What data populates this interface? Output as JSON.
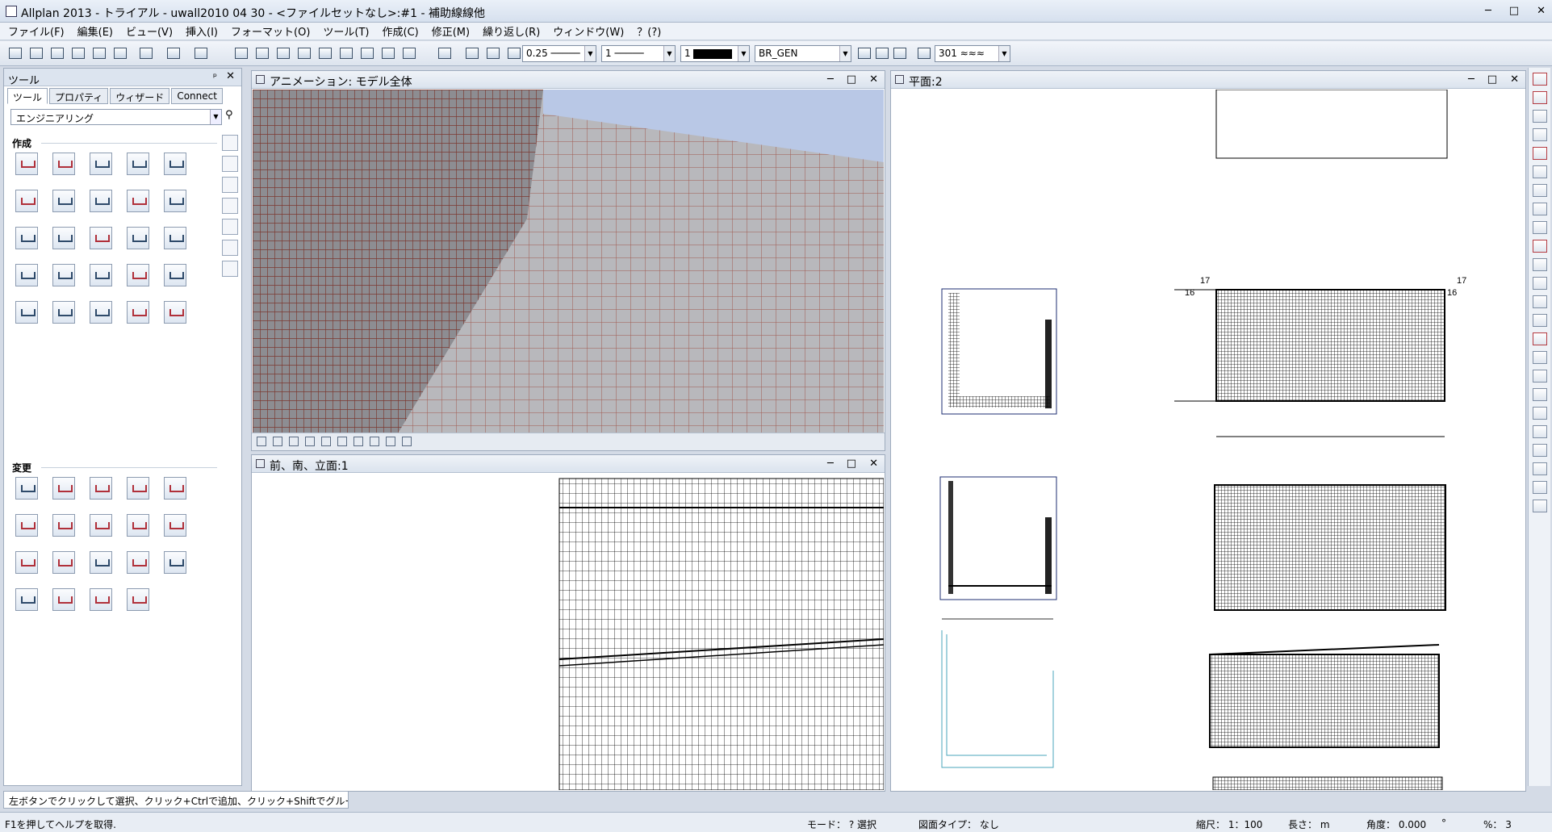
{
  "window": {
    "title": "Allplan 2013 - トライアル - uwall2010 04 30 - <ファイルセットなし>:#1 - 補助線線他",
    "min": "─",
    "max": "□",
    "close": "✕"
  },
  "menu": [
    "ファイル(F)",
    "編集(E)",
    "ビュー(V)",
    "挿入(I)",
    "フォーマット(O)",
    "ツール(T)",
    "作成(C)",
    "修正(M)",
    "繰り返し(R)",
    "ウィンドウ(W)",
    "？(?)"
  ],
  "toolbar": {
    "pen": "0.25",
    "line": "1",
    "color": "1",
    "layer": "BR_GEN",
    "pattern": "301"
  },
  "tools_panel": {
    "title": "ツール",
    "pin": "ᵖ",
    "close": "✕",
    "tabs": [
      "ツール",
      "プロパティ",
      "ウィザード",
      "Connect"
    ],
    "family": "エンジニアリング",
    "create_label": "作成",
    "modify_label": "変更"
  },
  "status_hint": "左ボタンでクリックして選択、クリック+Ctrlで追加、クリック+Shiftでグループ選択",
  "viewports": {
    "anim": {
      "title": "アニメーション: モデル全体"
    },
    "elev": {
      "title": "前、南、立面:1"
    },
    "plan": {
      "title": "平面:2"
    }
  },
  "statusbar": {
    "help": "F1を押してヘルプを取得.",
    "mode": "モード： ? 選択",
    "drawtype": "図面タイプ： なし",
    "scale": "縮尺： 1：100",
    "length": "長さ： m",
    "angle": "角度： 0.000",
    "deg": "°",
    "percent": "%： 3"
  },
  "plan_labels": {
    "n17a": "17",
    "n17b": "17",
    "n16a": "16",
    "n16b": "16"
  }
}
